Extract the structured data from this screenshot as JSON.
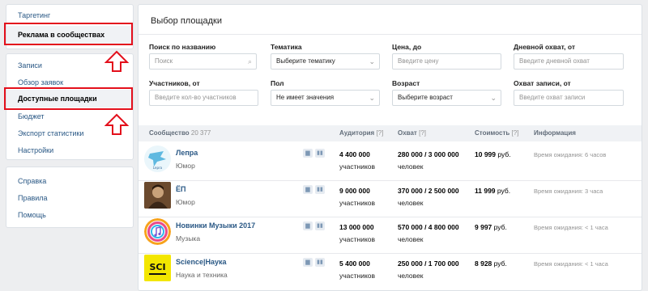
{
  "sidebar": {
    "group1": [
      {
        "label": "Таргетинг"
      },
      {
        "label": "Реклама в сообществах"
      }
    ],
    "group2": [
      {
        "label": "Записи"
      },
      {
        "label": "Обзор заявок"
      },
      {
        "label": "Доступные площадки"
      },
      {
        "label": "Бюджет"
      },
      {
        "label": "Экспорт статистики"
      },
      {
        "label": "Настройки"
      }
    ],
    "group3": [
      {
        "label": "Справка"
      },
      {
        "label": "Правила"
      },
      {
        "label": "Помощь"
      }
    ]
  },
  "main": {
    "title": "Выбор площадки",
    "filters": {
      "search": {
        "label": "Поиск по названию",
        "placeholder": "Поиск"
      },
      "topic": {
        "label": "Тематика",
        "value": "Выберите тематику"
      },
      "price": {
        "label": "Цена, до",
        "placeholder": "Введите цену"
      },
      "daily_reach": {
        "label": "Дневной охват, от",
        "placeholder": "Введите дневной охват"
      },
      "members": {
        "label": "Участников, от",
        "placeholder": "Введите кол-во участников"
      },
      "gender": {
        "label": "Пол",
        "value": "Не имеет значения"
      },
      "age": {
        "label": "Возраст",
        "value": "Выберите возраст"
      },
      "post_reach": {
        "label": "Охват записи, от",
        "placeholder": "Введите охват записи"
      }
    },
    "table": {
      "headers": {
        "community": "Сообщество",
        "community_count": "20 377",
        "audience": "Аудитория",
        "reach": "Охват",
        "cost": "Стоимость",
        "info": "Информация",
        "help": "[?]"
      },
      "rows": [
        {
          "name": "Лепра",
          "topic": "Юмор",
          "audience": "4 400 000",
          "audience_unit": "участников",
          "reach": "280 000 / 3 000 000",
          "reach_unit": "человек",
          "price": "10 999",
          "currency": "руб.",
          "wait": "Время ожидания: 6 часов"
        },
        {
          "name": "ЁП",
          "topic": "Юмор",
          "audience": "9 000 000",
          "audience_unit": "участников",
          "reach": "370 000 / 2 500 000",
          "reach_unit": "человек",
          "price": "11 999",
          "currency": "руб.",
          "wait": "Время ожидания: 3 часа"
        },
        {
          "name": "Новинки Музыки 2017",
          "topic": "Музыка",
          "audience": "13 000 000",
          "audience_unit": "участников",
          "reach": "570 000 / 4 800 000",
          "reach_unit": "человек",
          "price": "9 997",
          "currency": "руб.",
          "wait": "Время ожидания: < 1 часа"
        },
        {
          "name": "Science|Наука",
          "topic": "Наука и техника",
          "audience": "5 400 000",
          "audience_unit": "участников",
          "reach": "250 000 / 1 700 000",
          "reach_unit": "человек",
          "price": "8 928",
          "currency": "руб.",
          "wait": "Время ожидания: < 1 часа"
        }
      ]
    },
    "avatars": [
      "Lepra",
      "",
      "",
      "SCI"
    ]
  },
  "colors": {
    "link": "#2a5885",
    "highlight": "#e3101c",
    "background": "#edeef0"
  }
}
